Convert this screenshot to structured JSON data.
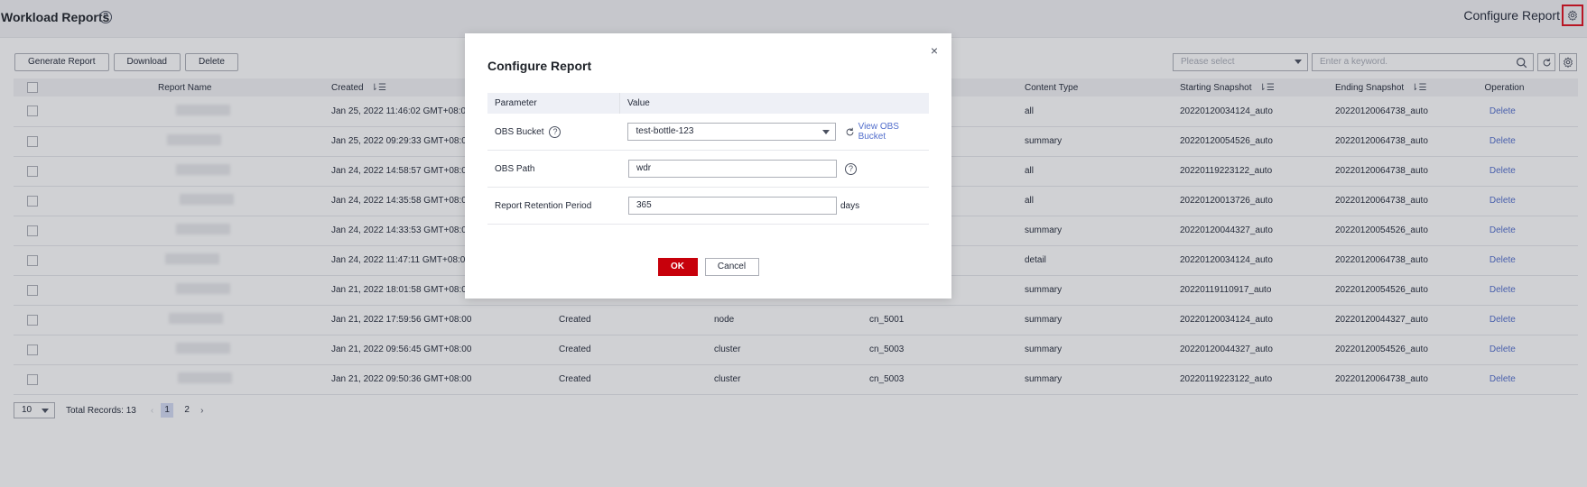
{
  "header": {
    "title": "Workload Reports",
    "configure_label": "Configure Report"
  },
  "toolbar": {
    "generate": "Generate Report",
    "download": "Download",
    "delete": "Delete",
    "select_placeholder": "Please select",
    "search_placeholder": "Enter a keyword."
  },
  "table": {
    "columns": [
      "Report Name",
      "Created",
      "Content Type",
      "Starting Snapshot",
      "Ending Snapshot",
      "Operation"
    ],
    "rows": [
      {
        "created": "Jan 25, 2022 11:46:02 GMT+08:00",
        "status": "",
        "scope": "",
        "node": "",
        "content": "all",
        "start": "20220120034124_auto",
        "end": "20220120064738_auto",
        "op": "Delete"
      },
      {
        "created": "Jan 25, 2022 09:29:33 GMT+08:00",
        "status": "",
        "scope": "",
        "node": "",
        "content": "summary",
        "start": "20220120054526_auto",
        "end": "20220120064738_auto",
        "op": "Delete"
      },
      {
        "created": "Jan 24, 2022 14:58:57 GMT+08:00",
        "status": "",
        "scope": "",
        "node": "",
        "content": "all",
        "start": "20220119223122_auto",
        "end": "20220120064738_auto",
        "op": "Delete"
      },
      {
        "created": "Jan 24, 2022 14:35:58 GMT+08:00",
        "status": "",
        "scope": "",
        "node": "",
        "content": "all",
        "start": "20220120013726_auto",
        "end": "20220120064738_auto",
        "op": "Delete"
      },
      {
        "created": "Jan 24, 2022 14:33:53 GMT+08:00",
        "status": "",
        "scope": "",
        "node": "",
        "content": "summary",
        "start": "20220120044327_auto",
        "end": "20220120054526_auto",
        "op": "Delete"
      },
      {
        "created": "Jan 24, 2022 11:47:11 GMT+08:00",
        "status": "",
        "scope": "",
        "node": "",
        "content": "detail",
        "start": "20220120034124_auto",
        "end": "20220120064738_auto",
        "op": "Delete"
      },
      {
        "created": "Jan 21, 2022 18:01:58 GMT+08:00",
        "status": "",
        "scope": "",
        "node": "",
        "content": "summary",
        "start": "20220119110917_auto",
        "end": "20220120054526_auto",
        "op": "Delete"
      },
      {
        "created": "Jan 21, 2022 17:59:56 GMT+08:00",
        "status": "Created",
        "scope": "node",
        "node": "cn_5001",
        "content": "summary",
        "start": "20220120034124_auto",
        "end": "20220120044327_auto",
        "op": "Delete"
      },
      {
        "created": "Jan 21, 2022 09:56:45 GMT+08:00",
        "status": "Created",
        "scope": "cluster",
        "node": "cn_5003",
        "content": "summary",
        "start": "20220120044327_auto",
        "end": "20220120054526_auto",
        "op": "Delete"
      },
      {
        "created": "Jan 21, 2022 09:50:36 GMT+08:00",
        "status": "Created",
        "scope": "cluster",
        "node": "cn_5003",
        "content": "summary",
        "start": "20220119223122_auto",
        "end": "20220120064738_auto",
        "op": "Delete"
      }
    ]
  },
  "pager": {
    "page_size": "10",
    "total": "Total Records: 13",
    "pages": [
      "1",
      "2"
    ]
  },
  "modal": {
    "title": "Configure Report",
    "col_param": "Parameter",
    "col_value": "Value",
    "bucket_label": "OBS Bucket",
    "bucket_value": "test-bottle-123",
    "view_bucket": "View OBS Bucket",
    "path_label": "OBS Path",
    "path_value": "wdr",
    "retention_label": "Report Retention Period",
    "retention_value": "365",
    "retention_unit": "days",
    "ok": "OK",
    "cancel": "Cancel",
    "close": "×"
  },
  "colors": {
    "primary_button": "#c7000b",
    "link": "#526ecc",
    "highlight_box": "#e0101e"
  }
}
